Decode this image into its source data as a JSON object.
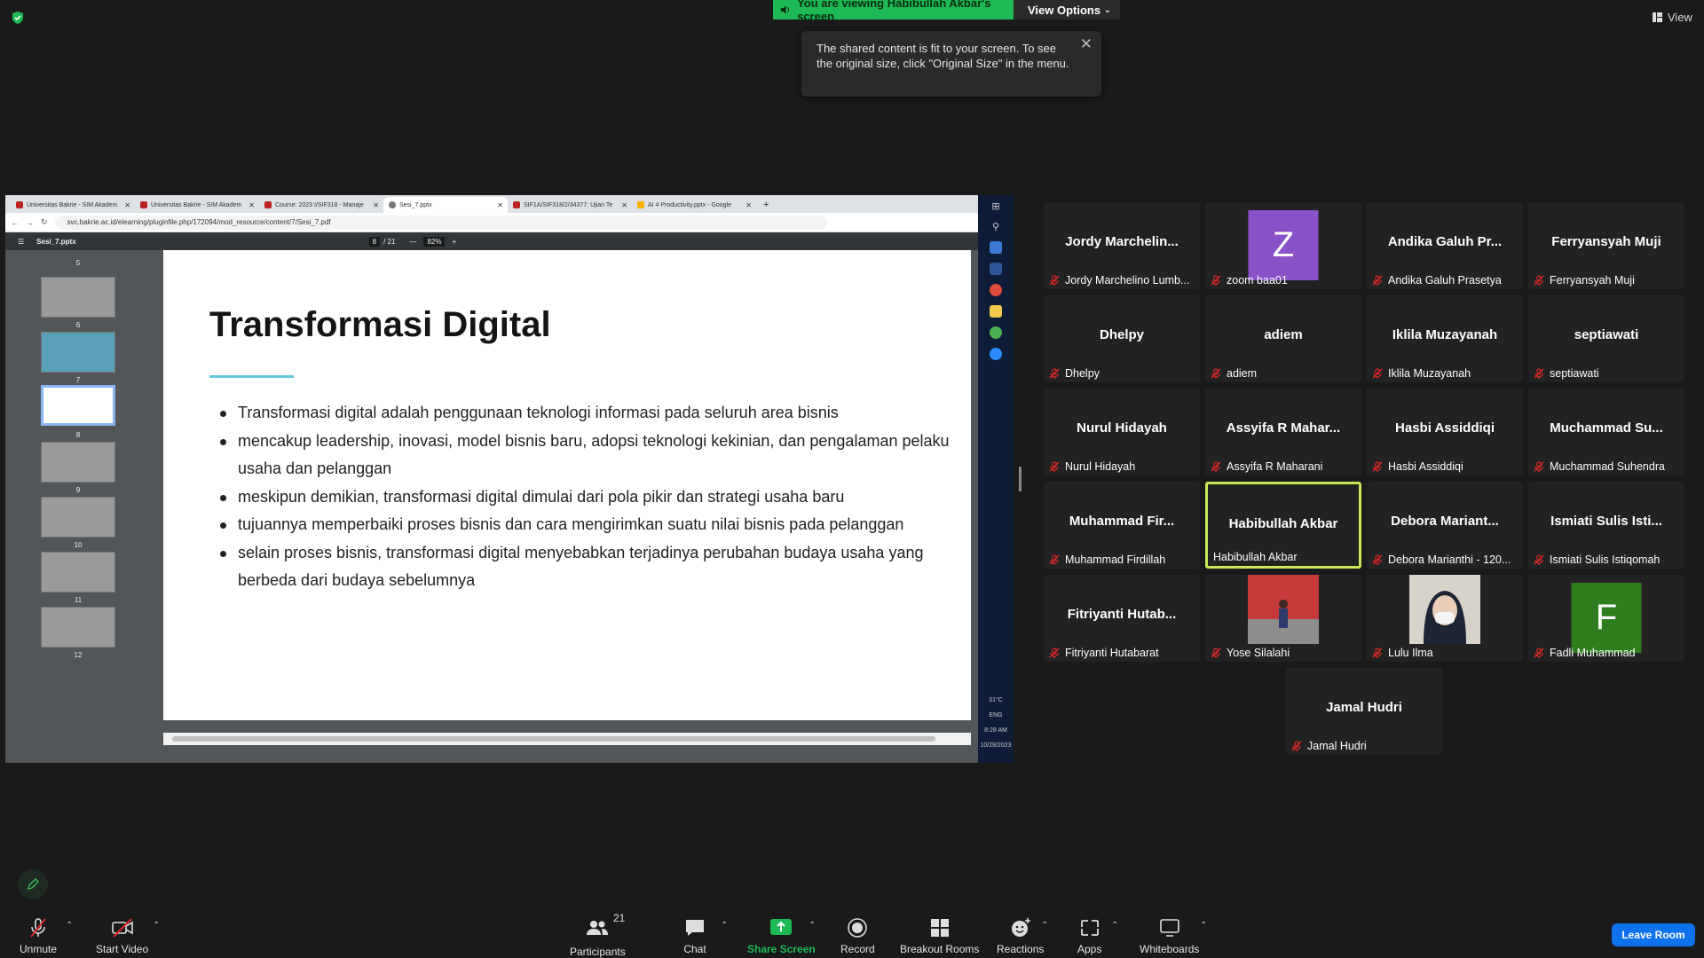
{
  "banner": {
    "viewing_text": "You are viewing Habibullah Akbar's screen",
    "view_options_label": "View Options"
  },
  "tooltip": {
    "text": "The shared content is fit to your screen. To see the original size, click \"Original Size\" in the menu."
  },
  "view_label": "View",
  "browser": {
    "tabs": [
      {
        "label": "Universitas Bakrie - SIM Akadem"
      },
      {
        "label": "Universitas Bakrie - SIM Akadem"
      },
      {
        "label": "Course: 2023 I/SIF318 - Manaje"
      },
      {
        "label": "Sesi_7.pptx"
      },
      {
        "label": "SIF1A/SIF318/2/34377: Ujian Te"
      },
      {
        "label": "AI 4 Productivity.pptx - Google"
      }
    ],
    "url": "svc.bakrie.ac.id/elearning/pluginfile.php/172094/mod_resource/content/7/Sesi_7.pdf",
    "pdf": {
      "filename": "Sesi_7.pptx",
      "page": "8",
      "pages": "/ 21",
      "zoom": "82%"
    },
    "thumbnails": [
      "5",
      "6",
      "7",
      "8",
      "9",
      "10",
      "11",
      "12"
    ]
  },
  "slide": {
    "title": "Transformasi Digital",
    "bullets": [
      "Transformasi digital adalah penggunaan teknologi informasi pada seluruh area bisnis",
      "mencakup leadership, inovasi, model bisnis baru, adopsi teknologi kekinian, dan pengalaman pelaku usaha dan pelanggan",
      "meskipun demikian, transformasi digital dimulai dari pola pikir dan strategi usaha baru",
      "tujuannya memperbaiki proses bisnis dan cara mengirimkan suatu nilai bisnis pada pelanggan",
      "selain proses bisnis, transformasi digital menyebabkan terjadinya perubahan budaya usaha yang berbeda dari budaya sebelumnya"
    ]
  },
  "taskbar": {
    "temp": "31°C",
    "lang": "ENG",
    "time": "8:28 AM",
    "date": "10/28/2023"
  },
  "participants": [
    {
      "name": "Jordy  Marchelin...",
      "label": "Jordy Marchelino Lumb..."
    },
    {
      "name": "Z",
      "label": "zoom baa01",
      "avatar_color": "#8a52c9"
    },
    {
      "name": "Andika  Galuh  Pr...",
      "label": "Andika Galuh Prasetya"
    },
    {
      "name": "Ferryansyah Muji",
      "label": "Ferryansyah Muji"
    },
    {
      "name": "Dhelpy",
      "label": "Dhelpy"
    },
    {
      "name": "adiem",
      "label": "adiem"
    },
    {
      "name": "Iklila Muzayanah",
      "label": "Iklila Muzayanah"
    },
    {
      "name": "septiawati",
      "label": "septiawati"
    },
    {
      "name": "Nurul Hidayah",
      "label": "Nurul Hidayah"
    },
    {
      "name": "Assyifa  R  Mahar...",
      "label": "Assyifa R Maharani"
    },
    {
      "name": "Hasbi Assiddiqi",
      "label": "Hasbi Assiddiqi"
    },
    {
      "name": "Muchammad  Su...",
      "label": "Muchammad Suhendra"
    },
    {
      "name": "Muhammad  Fir...",
      "label": "Muhammad Firdillah"
    },
    {
      "name": "Habibullah Akbar",
      "label": "Habibullah Akbar"
    },
    {
      "name": "Debora  Mariant...",
      "label": "Debora Marianthi - 120..."
    },
    {
      "name": "Ismiati  Sulis  Isti...",
      "label": "Ismiati Sulis Istiqomah"
    },
    {
      "name": "Fitriyanti  Hutab...",
      "label": "Fitriyanti Hutabarat"
    },
    {
      "name": "",
      "label": "Yose Silalahi"
    },
    {
      "name": "",
      "label": "Lulu Ilma"
    },
    {
      "name": "F",
      "label": "Fadli Muhammad",
      "avatar_color": "#2e7d1f"
    },
    {
      "name": "Jamal Hudri",
      "label": "Jamal Hudri"
    }
  ],
  "toolbar": {
    "unmute": "Unmute",
    "start_video": "Start Video",
    "participants": "Participants",
    "participants_count": "21",
    "chat": "Chat",
    "share_screen": "Share Screen",
    "record": "Record",
    "breakout": "Breakout Rooms",
    "reactions": "Reactions",
    "apps": "Apps",
    "whiteboards": "Whiteboards",
    "leave": "Leave Room"
  },
  "colors": {
    "share_green": "#1db954",
    "leave_blue": "#0e72ed",
    "active_speaker": "#c8e857"
  }
}
